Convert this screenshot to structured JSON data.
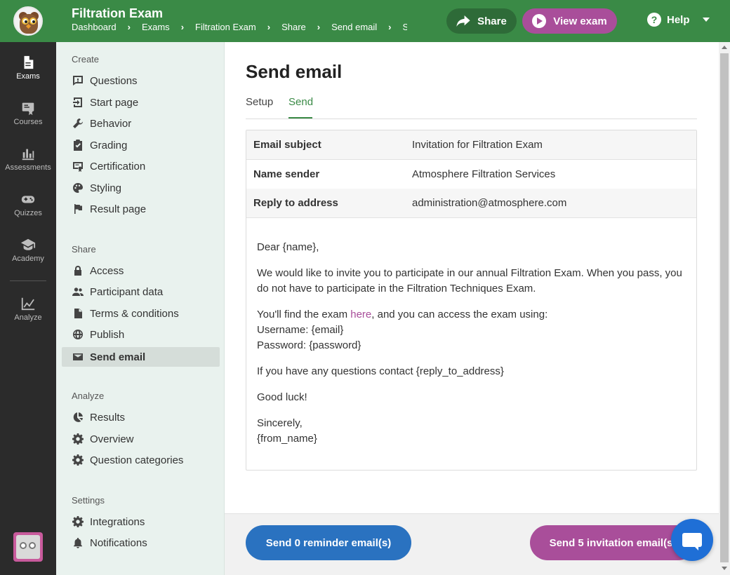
{
  "app": {
    "title": "Filtration Exam",
    "breadcrumb": [
      "Dashboard",
      "Exams",
      "Filtration Exam",
      "Share",
      "Send email",
      "S"
    ]
  },
  "topbar": {
    "share_label": "Share",
    "view_exam_label": "View exam",
    "help_label": "Help",
    "help_icon_text": "?"
  },
  "rail": {
    "items": [
      {
        "label": "Exams",
        "icon": "document-icon"
      },
      {
        "label": "Courses",
        "icon": "courses-icon"
      },
      {
        "label": "Assessments",
        "icon": "bar-chart-icon"
      },
      {
        "label": "Quizzes",
        "icon": "gamepad-icon"
      },
      {
        "label": "Academy",
        "icon": "graduation-cap-icon"
      },
      {
        "label": "Analyze",
        "icon": "line-chart-icon"
      }
    ]
  },
  "sidenav": {
    "create_heading": "Create",
    "create_items": [
      "Questions",
      "Start page",
      "Behavior",
      "Grading",
      "Certification",
      "Styling",
      "Result page"
    ],
    "share_heading": "Share",
    "share_items": [
      "Access",
      "Participant data",
      "Terms & conditions",
      "Publish",
      "Send email"
    ],
    "analyze_heading": "Analyze",
    "analyze_items": [
      "Results",
      "Overview",
      "Question categories"
    ],
    "settings_heading": "Settings",
    "settings_items": [
      "Integrations",
      "Notifications"
    ]
  },
  "main": {
    "page_title": "Send email",
    "tabs": [
      "Setup",
      "Send"
    ],
    "active_tab": "Send",
    "fields": [
      {
        "label": "Email subject",
        "value": "Invitation for Filtration Exam"
      },
      {
        "label": "Name sender",
        "value": "Atmosphere Filtration Services"
      },
      {
        "label": "Reply to address",
        "value": "administration@atmosphere.com"
      }
    ],
    "body": {
      "greeting": "Dear {name},",
      "para1": "We would like to invite you to participate in our annual Filtration Exam. When you pass, you do not have to participate in the Filtration Techniques Exam.",
      "para2_pre": "You'll find the exam ",
      "para2_link": "here",
      "para2_post": ", and you can access the exam using:",
      "username_line": "Username: {email}",
      "password_line": "Password: {password}",
      "para3": "If you have any questions contact {reply_to_address}",
      "para4": "Good luck!",
      "closing": "Sincerely,",
      "signature": "{from_name}"
    }
  },
  "footer": {
    "reminder_label": "Send 0 reminder email(s)",
    "invite_label": "Send 5 invitation email(s)"
  },
  "colors": {
    "brand_green": "#3a8a46",
    "accent_purple": "#a94e9a",
    "accent_blue": "#2a72c0"
  }
}
